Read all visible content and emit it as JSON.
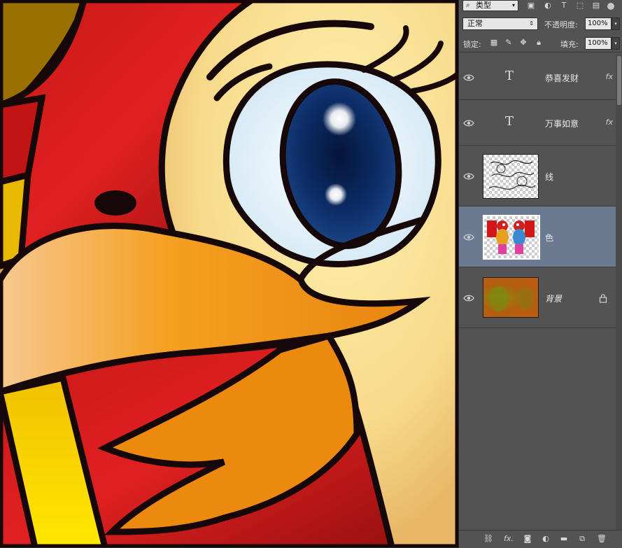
{
  "panel": {
    "filter_label": "类型",
    "blend_mode": "正常",
    "opacity_label": "不透明度:",
    "opacity_value": "100%",
    "lock_label": "锁定:",
    "fill_label": "填充:",
    "fill_value": "100%"
  },
  "layers": [
    {
      "name": "恭喜发财",
      "kind": "text",
      "fx": "fx",
      "selected": false
    },
    {
      "name": "万事如意",
      "kind": "text",
      "fx": "fx",
      "selected": false
    },
    {
      "name": "线",
      "kind": "pixel",
      "selected": false
    },
    {
      "name": "色",
      "kind": "pixel",
      "selected": true
    },
    {
      "name": "背景",
      "kind": "background",
      "locked": true,
      "selected": false
    }
  ],
  "icons": {
    "filter_search": "search-icon",
    "filter_types": [
      "image-filter-icon",
      "adjustment-filter-icon",
      "text-filter-icon",
      "shape-filter-icon",
      "smart-object-filter-icon"
    ],
    "locks": [
      "lock-transparent-icon",
      "lock-paint-icon",
      "lock-move-icon",
      "lock-all-icon"
    ],
    "bottom": [
      "link-icon",
      "fx-icon",
      "mask-icon",
      "adjustment-icon",
      "folder-icon",
      "new-layer-icon",
      "trash-icon"
    ]
  },
  "colors": {
    "panel_bg": "#535353",
    "selected_layer": "#6b7a91"
  }
}
